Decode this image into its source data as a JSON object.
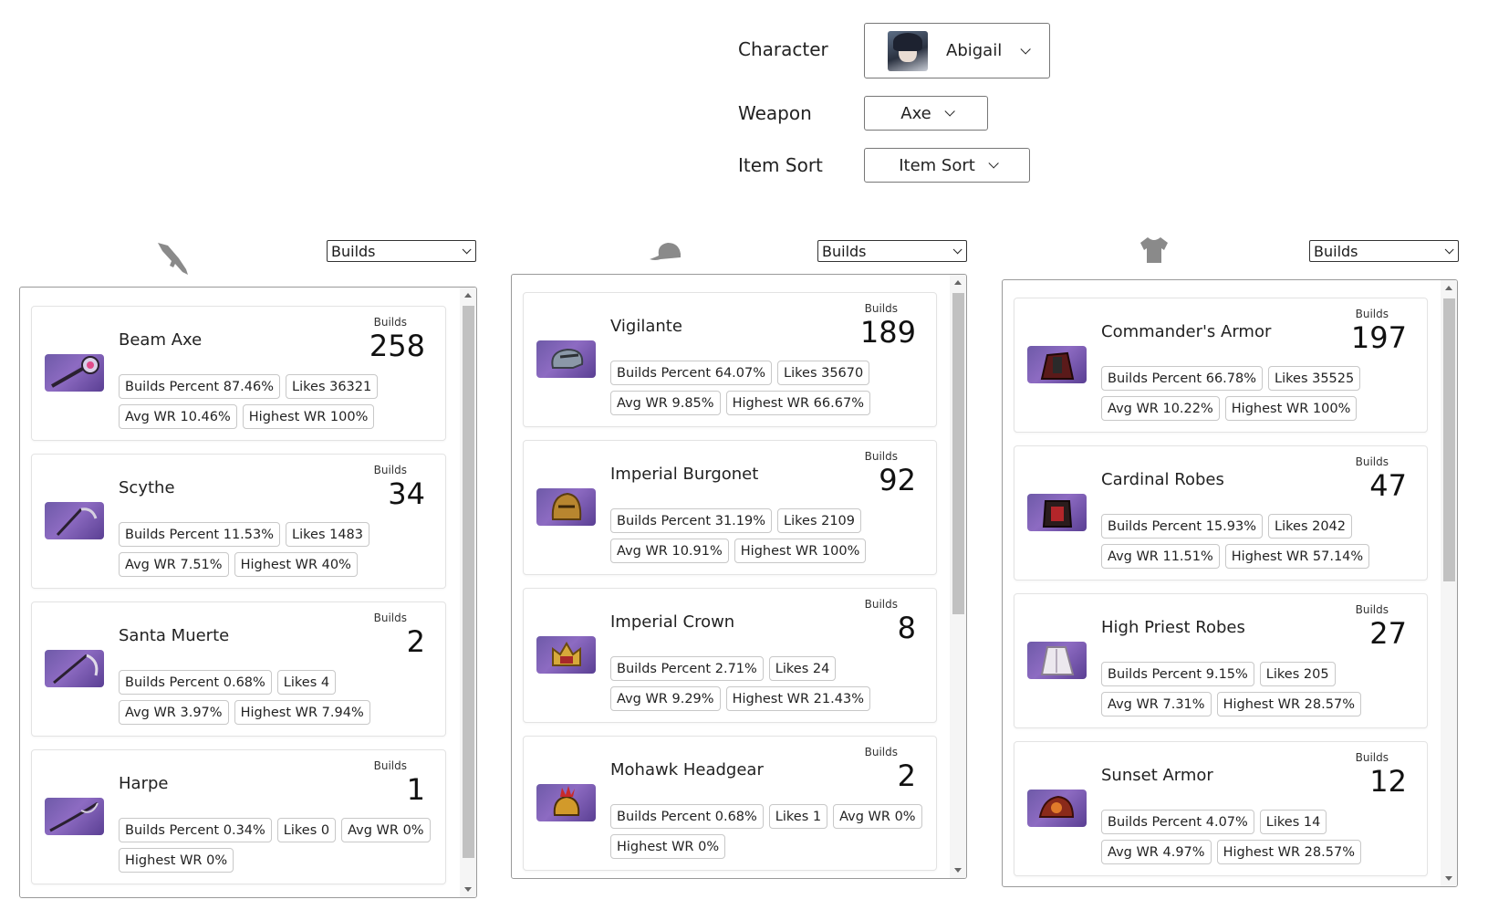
{
  "filters": {
    "character": {
      "label": "Character",
      "value": "Abigail"
    },
    "weapon": {
      "label": "Weapon",
      "value": "Axe"
    },
    "item_sort": {
      "label": "Item Sort",
      "value": "Item Sort"
    }
  },
  "columns": [
    {
      "icon": "weapon-icon",
      "sort_value": "Builds",
      "items": [
        {
          "name": "Beam Axe",
          "builds_label": "Builds",
          "builds": "258",
          "stats": [
            "Builds Percent 87.46%",
            "Likes 36321",
            "Avg WR 10.46%",
            "Highest WR 100%"
          ]
        },
        {
          "name": "Scythe",
          "builds_label": "Builds",
          "builds": "34",
          "stats": [
            "Builds Percent 11.53%",
            "Likes 1483",
            "Avg WR 7.51%",
            "Highest WR 40%"
          ]
        },
        {
          "name": "Santa Muerte",
          "builds_label": "Builds",
          "builds": "2",
          "stats": [
            "Builds Percent 0.68%",
            "Likes 4",
            "Avg WR 3.97%",
            "Highest WR 7.94%"
          ]
        },
        {
          "name": "Harpe",
          "builds_label": "Builds",
          "builds": "1",
          "stats": [
            "Builds Percent 0.34%",
            "Likes 0",
            "Avg WR 0%",
            "Highest WR 0%"
          ]
        }
      ]
    },
    {
      "icon": "helmet-icon",
      "sort_value": "Builds",
      "items": [
        {
          "name": "Vigilante",
          "builds_label": "Builds",
          "builds": "189",
          "stats": [
            "Builds Percent 64.07%",
            "Likes 35670",
            "Avg WR 9.85%",
            "Highest WR 66.67%"
          ]
        },
        {
          "name": "Imperial Burgonet",
          "builds_label": "Builds",
          "builds": "92",
          "stats": [
            "Builds Percent 31.19%",
            "Likes 2109",
            "Avg WR 10.91%",
            "Highest WR 100%"
          ]
        },
        {
          "name": "Imperial Crown",
          "builds_label": "Builds",
          "builds": "8",
          "stats": [
            "Builds Percent 2.71%",
            "Likes 24",
            "Avg WR 9.29%",
            "Highest WR 21.43%"
          ]
        },
        {
          "name": "Mohawk Headgear",
          "builds_label": "Builds",
          "builds": "2",
          "stats": [
            "Builds Percent 0.68%",
            "Likes 1",
            "Avg WR 0%",
            "Highest WR 0%"
          ]
        }
      ]
    },
    {
      "icon": "shirt-icon",
      "sort_value": "Builds",
      "items": [
        {
          "name": "Commander's Armor",
          "builds_label": "Builds",
          "builds": "197",
          "stats": [
            "Builds Percent 66.78%",
            "Likes 35525",
            "Avg WR 10.22%",
            "Highest WR 100%"
          ]
        },
        {
          "name": "Cardinal Robes",
          "builds_label": "Builds",
          "builds": "47",
          "stats": [
            "Builds Percent 15.93%",
            "Likes 2042",
            "Avg WR 11.51%",
            "Highest WR 57.14%"
          ]
        },
        {
          "name": "High Priest Robes",
          "builds_label": "Builds",
          "builds": "27",
          "stats": [
            "Builds Percent 9.15%",
            "Likes 205",
            "Avg WR 7.31%",
            "Highest WR 28.57%"
          ]
        },
        {
          "name": "Sunset Armor",
          "builds_label": "Builds",
          "builds": "12",
          "stats": [
            "Builds Percent 4.07%",
            "Likes 14",
            "Avg WR 4.97%",
            "Highest WR 28.57%"
          ]
        }
      ]
    }
  ]
}
